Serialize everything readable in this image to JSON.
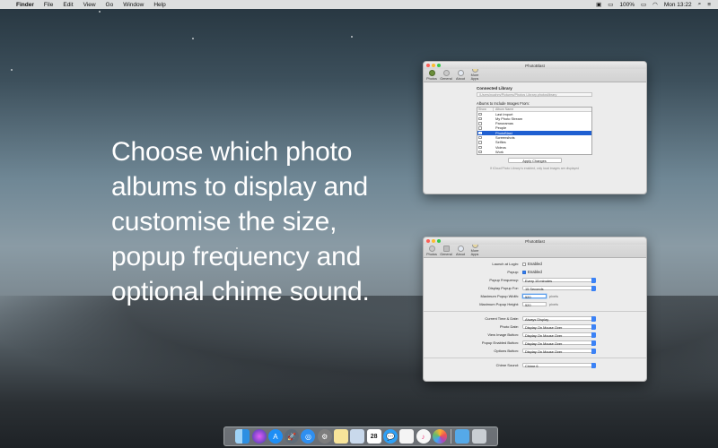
{
  "menubar": {
    "apple": "",
    "app_name": "Finder",
    "items": [
      "File",
      "Edit",
      "View",
      "Go",
      "Window",
      "Help"
    ],
    "battery": "100%",
    "clock": "Mon 13:22"
  },
  "headline": "Choose which photo albums to display and customise the size, popup frequency and optional chime sound.",
  "window1": {
    "title": "PhotoBlast",
    "toolbar": [
      "Photos",
      "General",
      "About",
      "More Apps"
    ],
    "connected_library_label": "Connected Library",
    "library_path": "/Users/noahm/Pictures/Photos Library.photoslibrary",
    "albums_label": "Albums to Include Images From:",
    "column_show": "Show",
    "column_album": "Album Name",
    "albums": [
      {
        "name": "Last Import",
        "checked": false,
        "selected": false
      },
      {
        "name": "My Photo Stream",
        "checked": false,
        "selected": false
      },
      {
        "name": "Panoramas",
        "checked": false,
        "selected": false
      },
      {
        "name": "People",
        "checked": false,
        "selected": false
      },
      {
        "name": "PhotoBlast",
        "checked": true,
        "selected": true
      },
      {
        "name": "Screenshots",
        "checked": false,
        "selected": false
      },
      {
        "name": "Selfies",
        "checked": false,
        "selected": false
      },
      {
        "name": "Videos",
        "checked": false,
        "selected": false
      },
      {
        "name": "Work",
        "checked": false,
        "selected": false
      }
    ],
    "apply_button": "Apply Changes",
    "footnote": "If iCloud Photo Library is enabled, only local images are displayed"
  },
  "window2": {
    "title": "PhotoBlast",
    "toolbar": [
      "Photos",
      "General",
      "About",
      "More Apps"
    ],
    "launch_at_login_label": "Launch at Login:",
    "launch_at_login_value": "Enabled",
    "popup_label": "Popup:",
    "popup_value": "Enabled",
    "popup_frequency_label": "Popup Frequency:",
    "popup_frequency_value": "Every 15 minutes",
    "display_popup_for_label": "Display Popup For:",
    "display_popup_for_value": "15 Seconds",
    "max_width_label": "Maximum Popup Width:",
    "max_width_value": "520",
    "max_height_label": "Maximum Popup Height:",
    "max_height_value": "520",
    "unit": "pixels",
    "current_time_label": "Current Time & Date:",
    "current_time_value": "Always Display",
    "photo_date_label": "Photo Date:",
    "photo_date_value": "Display On Mouse Over",
    "view_image_label": "View Image Button:",
    "view_image_value": "Display On Mouse Over",
    "popup_enabled_label": "Popup Enabled Button:",
    "popup_enabled_value": "Display On Mouse Over",
    "options_label": "Options Button:",
    "options_value": "Display On Mouse Over",
    "chime_label": "Chime Sound:",
    "chime_value": "Chime 6"
  },
  "dock": {
    "icons": [
      "finder-icon",
      "siri-icon",
      "app-store-icon",
      "launchpad-icon",
      "safari-icon",
      "system-preferences-icon",
      "notes-icon",
      "preview-icon",
      "calendar-icon",
      "messages-icon",
      "reminders-icon",
      "itunes-icon",
      "photos-icon",
      "downloads-folder-icon",
      "trash-icon"
    ],
    "calendar_day": "28"
  }
}
